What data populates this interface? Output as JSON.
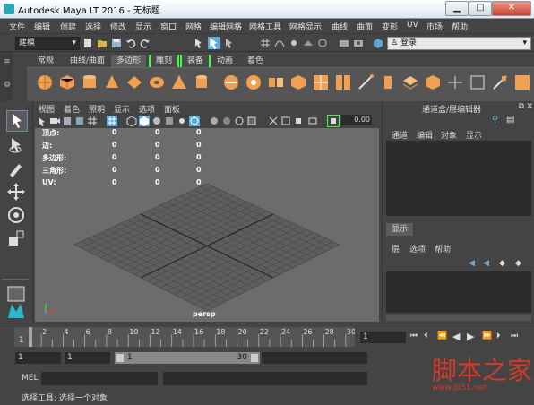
{
  "window": {
    "title": "Autodesk Maya LT 2016 - 无标题",
    "minimize": "▁",
    "maximize": "□",
    "close": "✕"
  },
  "menubar": [
    "文件",
    "编辑",
    "创建",
    "选择",
    "修改",
    "显示",
    "窗口",
    "网格",
    "编辑网格",
    "网格工具",
    "网格显示",
    "曲线",
    "曲面",
    "变形",
    "UV",
    "市场",
    "帮助"
  ],
  "statusline": {
    "mode": "建模",
    "login": "登录"
  },
  "shelf": {
    "tabs": [
      "常规",
      "曲线/曲面",
      "多边形",
      "雕刻",
      "装备",
      "动画",
      "着色"
    ],
    "active_tab": "多边形"
  },
  "viewport": {
    "menu": [
      "视图",
      "着色",
      "照明",
      "显示",
      "选项",
      "面板"
    ],
    "field_value": "0.00",
    "hud": {
      "rows": [
        {
          "label": "顶点:",
          "v1": "0",
          "v2": "0",
          "v3": "0"
        },
        {
          "label": "边:",
          "v1": "0",
          "v2": "0",
          "v3": "0"
        },
        {
          "label": "多边形:",
          "v1": "0",
          "v2": "0",
          "v3": "0"
        },
        {
          "label": "三角形:",
          "v1": "0",
          "v2": "0",
          "v3": "0"
        },
        {
          "label": "UV:",
          "v1": "0",
          "v2": "0",
          "v3": "0"
        }
      ]
    },
    "camera_label": "persp"
  },
  "channelbox": {
    "title": "通道盒/层编辑器",
    "menu": [
      "通道",
      "编辑",
      "对象",
      "显示"
    ],
    "layer_tab": "显示",
    "layer_menu": [
      "层",
      "选项",
      "帮助"
    ]
  },
  "timeline": {
    "ticks": [
      "2",
      "4",
      "6",
      "8",
      "10",
      "12",
      "14",
      "16",
      "18",
      "20",
      "22",
      "24",
      "26",
      "28",
      "30"
    ],
    "start_marker": "1",
    "current_frame": "1"
  },
  "range": {
    "start": "1",
    "playback_start": "1",
    "slider_start": "1",
    "slider_end": "30"
  },
  "mel": {
    "label": "MEL"
  },
  "helpline": {
    "text": "选择工具: 选择一个对象"
  },
  "watermark": {
    "text": "脚本之家",
    "url": "www.jb51.net"
  },
  "colors": {
    "ui_bg": "#444444",
    "viewport_bg": "#6c6c6c",
    "accent_green": "#3cff3c",
    "select_blue": "#5aa9d6",
    "watermark_red": "#d23a2a"
  }
}
